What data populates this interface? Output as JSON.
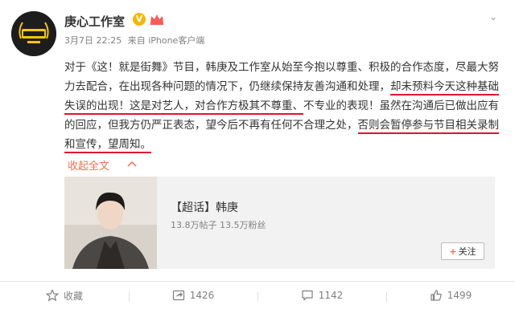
{
  "post": {
    "author": "庚心工作室",
    "verified_mark": "V",
    "date": "3月7日 22:25",
    "source": "来自 iPhone客户端",
    "avatar_text": "庚心工作室",
    "body": {
      "p1": "对于《这！就是街舞》节目，韩庚及工作室从始至今抱以尊重、积极的合作态度，尽最大努力去配合，在出现各种问题的情况下，仍继续保持友善沟通和处理，",
      "h1": "却未预料今天这种基础失误的出现！这是对艺人，对合作方极其不尊重、",
      "p2": "不专业的表现！虽然在沟通后已做出应有的回应，但我方仍严正表态，望今后不再有任何不合理之处，",
      "h2": "否则会暂停参与节目相关录制和宣传，望周知。"
    },
    "collapse_label": "收起全文"
  },
  "card": {
    "title": "【超话】韩庚",
    "stats": "13.8万帖子 13.5万粉丝",
    "follow_label": "关注"
  },
  "toolbar": {
    "favorite_label": "收藏",
    "repost_count": "1426",
    "comment_count": "1142",
    "like_count": "1499"
  },
  "colors": {
    "link": "#eb7350",
    "underline": "#e0142f",
    "badge": "#f7b500"
  }
}
